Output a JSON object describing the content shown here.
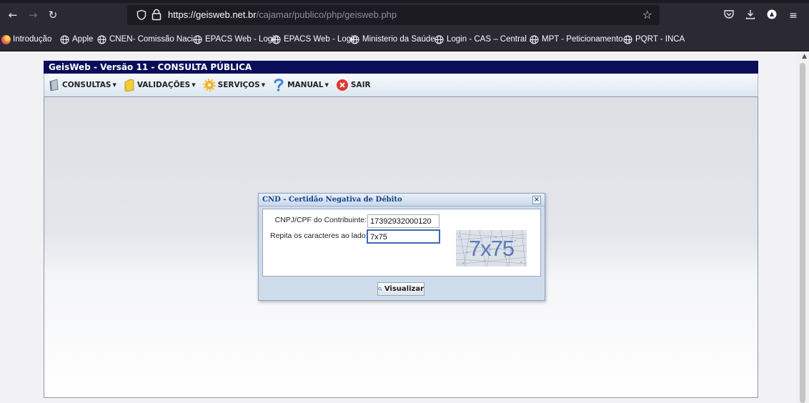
{
  "browser": {
    "url_host": "https://geisweb.net.br",
    "url_path": "/cajamar/publico/php/geisweb.php",
    "bookmarks": [
      {
        "label": "Introdução"
      },
      {
        "label": "Apple"
      },
      {
        "label": "CNEN- Comissão Naci..."
      },
      {
        "label": "EPACS Web - Login"
      },
      {
        "label": "EPACS Web - Login"
      },
      {
        "label": "Ministerio da Saúde"
      },
      {
        "label": "Login - CAS – Central ..."
      },
      {
        "label": "MPT - Peticionamento..."
      },
      {
        "label": "PQRT - INCA"
      }
    ]
  },
  "app": {
    "title": "GeisWeb - Versão 11 - CONSULTA PÚBLICA",
    "menu": {
      "consultas": "CONSULTAS",
      "validacoes": "VALIDAÇÕES",
      "servicos": "SERVIÇOS",
      "manual": "MANUAL",
      "sair": "SAIR"
    }
  },
  "dialog": {
    "title": "CND - Certidão Negativa de Débito",
    "close": "×",
    "cnpj_label": "CNPJ/CPF do Contribuinte:",
    "cnpj_value": "17392932000120",
    "captcha_label": "Repita os caracteres ao lado:",
    "captcha_value": "7x75",
    "captcha_image_text": "7x75",
    "submit_label": "Visualizar"
  },
  "colors": {
    "app_title_bg": "#0a0e59",
    "dialog_title": "#15428b",
    "browser_chrome": "#2b2a33"
  }
}
